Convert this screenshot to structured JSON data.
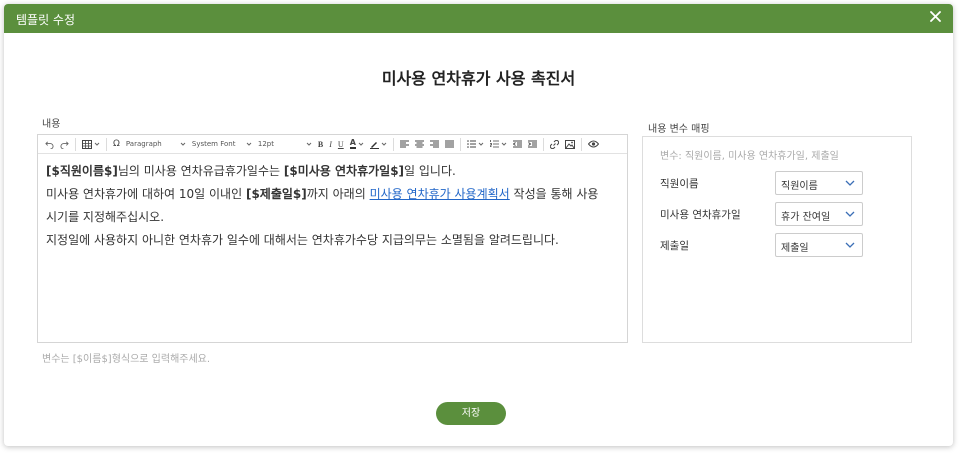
{
  "modal": {
    "title": "템플릿 수정"
  },
  "document": {
    "title": "미사용 연차휴가 사용 촉진서"
  },
  "content": {
    "label": "내용",
    "toolbar": {
      "block_format": "Paragraph",
      "font_family": "System Font",
      "font_size": "12pt",
      "bold": "B",
      "italic": "I",
      "underline": "U",
      "font_color": "A"
    },
    "body": {
      "line1": {
        "var1": "[$직원이름$]",
        "text1": "님의 미사용 연차유급휴가일수는 ",
        "var2": "[$미사용 연차휴가일$]",
        "text2": "일 입니다."
      },
      "line2": {
        "text1": "미사용 연차휴가에 대하여 10일 이내인 ",
        "var1": "[$제출일$]",
        "text2": "까지 아래의 ",
        "link": "미사용 연차휴가 사용계획서",
        "text3": " 작성을 통해 사용"
      },
      "line3": "시기를 지정해주십시오.",
      "line4": "지정일에 사용하지 아니한 연차휴가 일수에 대해서는 연차휴가수당 지급의무는 소멸됨을 알려드립니다."
    },
    "hint": "변수는 [$이름$]형식으로 입력해주세요."
  },
  "mapping": {
    "label": "내용 변수 매핑",
    "placeholder": "변수: 직원이름, 미사용 연차휴가일, 제출일",
    "rows": [
      {
        "name": "직원이름",
        "value": "직원이름"
      },
      {
        "name": "미사용 연차휴가일",
        "value": "휴가 잔여일"
      },
      {
        "name": "제출일",
        "value": "제출일"
      }
    ]
  },
  "actions": {
    "save_label": "저장"
  },
  "colors": {
    "header_green": "#5b8f3d",
    "link_blue": "#2166c8"
  }
}
